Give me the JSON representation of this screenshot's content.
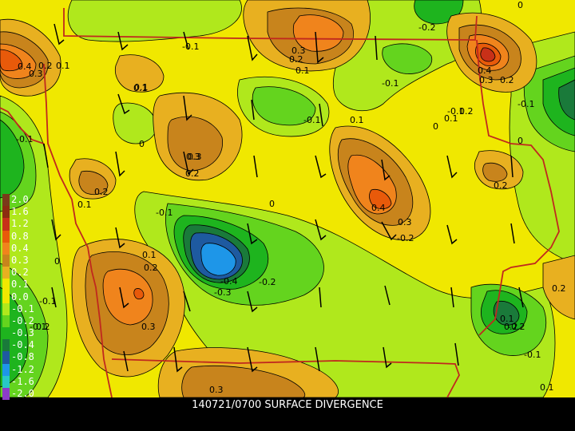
{
  "title": "140721/0700 SURFACE DIVERGENCE",
  "background_color": "#f0e800",
  "border_color": "#c0281e",
  "legend": [
    {
      "label": "2.0",
      "color": "#7a3a1a"
    },
    {
      "label": "1.6",
      "color": "#8c2c10"
    },
    {
      "label": "1.2",
      "color": "#c83018"
    },
    {
      "label": "0.8",
      "color": "#e85a0a"
    },
    {
      "label": "0.4",
      "color": "#f0841c"
    },
    {
      "label": "0.3",
      "color": "#c8841c"
    },
    {
      "label": "0.2",
      "color": "#e8b020"
    },
    {
      "label": "0.1",
      "color": "#f0e800"
    },
    {
      "label": "0.0",
      "color": "#f0e800"
    },
    {
      "label": "-0.1",
      "color": "#b0e81c"
    },
    {
      "label": "-0.2",
      "color": "#64d41e"
    },
    {
      "label": "-0.3",
      "color": "#1eb41e"
    },
    {
      "label": "-0.4",
      "color": "#1a7a3a"
    },
    {
      "label": "-0.8",
      "color": "#1e5aa0"
    },
    {
      "label": "-1.2",
      "color": "#1e96e8"
    },
    {
      "label": "-1.6",
      "color": "#28c8c8"
    },
    {
      "label": "-2.0",
      "color": "#8c3cc8"
    }
  ],
  "contour_labels": [
    "0.4",
    "0.3",
    "0.2",
    "0.1",
    "0.3",
    "0.2",
    "0.1",
    "-0.1",
    "0.1",
    "0.3",
    "0.2",
    "-0.2",
    "0",
    "0.1",
    "0.4",
    "0.3",
    "0.2",
    "0",
    "-0.1",
    "-0.1",
    "0.1",
    "-0.1",
    "-0.1",
    "0",
    "-0.1",
    "0.3",
    "0.2",
    "0",
    "0.2",
    "0.1",
    "-0.1",
    "0.1",
    "0.2",
    "-0.1",
    "0",
    "0.4",
    "0.3",
    "-0.2",
    "0.2",
    "0.1",
    "0.2",
    "0",
    "-0.4",
    "-0.3",
    "-0.2",
    "0.3",
    "0.1",
    "0.2",
    "-0.2",
    "-0.1",
    "0.2",
    "-0.1",
    "0.3",
    "0.1"
  ]
}
